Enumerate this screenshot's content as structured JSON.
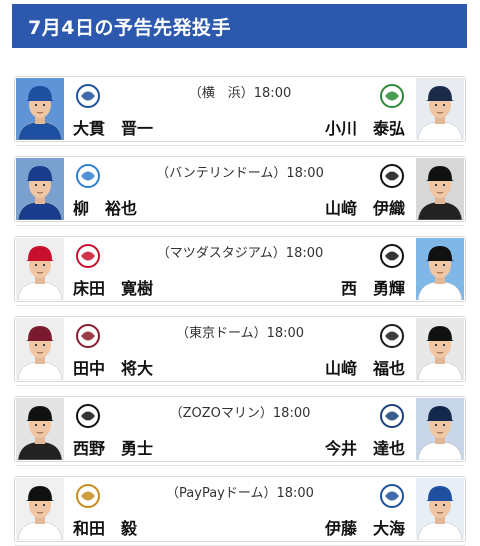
{
  "header": {
    "title": "7月4日の予告先発投手"
  },
  "games": [
    {
      "venue": "（横　浜）18:00",
      "home": {
        "name": "大貫　晋一",
        "team_logo": "baystars-logo",
        "cap": "#1f4fa0",
        "uniform": "#1f4fa0",
        "bg": "#5f95d6"
      },
      "away": {
        "name": "小川　泰弘",
        "team_logo": "swallows-logo",
        "cap": "#1a2a4a",
        "uniform": "#ffffff",
        "bg": "#e8ecf0"
      }
    },
    {
      "venue": "（バンテリンドーム）18:00",
      "home": {
        "name": "柳　裕也",
        "team_logo": "dragons-logo",
        "cap": "#1a3c8c",
        "uniform": "#1a3c8c",
        "bg": "#7aa0d0"
      },
      "away": {
        "name": "山﨑　伊織",
        "team_logo": "giants-logo",
        "cap": "#111111",
        "uniform": "#222222",
        "bg": "#d8d8d8"
      }
    },
    {
      "venue": "（マツダスタジアム）18:00",
      "home": {
        "name": "床田　寛樹",
        "team_logo": "carp-logo",
        "cap": "#c8102e",
        "uniform": "#ffffff",
        "bg": "#eeeeee"
      },
      "away": {
        "name": "西　勇輝",
        "team_logo": "tigers-logo",
        "cap": "#111111",
        "uniform": "#ffffff",
        "bg": "#7fb7e6"
      }
    },
    {
      "venue": "（東京ドーム）18:00",
      "home": {
        "name": "田中　将大",
        "team_logo": "eagles-logo",
        "cap": "#7a1a2e",
        "uniform": "#ffffff",
        "bg": "#eeeeee"
      },
      "away": {
        "name": "山﨑　福也",
        "team_logo": "buffaloes-logo",
        "cap": "#111111",
        "uniform": "#ffffff",
        "bg": "#e8e8e8"
      }
    },
    {
      "venue": "（ZOZOマリン）18:00",
      "home": {
        "name": "西野　勇士",
        "team_logo": "marines-logo",
        "cap": "#111111",
        "uniform": "#222222",
        "bg": "#e4e4e4"
      },
      "away": {
        "name": "今井　達也",
        "team_logo": "lions-logo",
        "cap": "#12284c",
        "uniform": "#ffffff",
        "bg": "#c8d6ea"
      }
    },
    {
      "venue": "（PayPayドーム）18:00",
      "home": {
        "name": "和田　毅",
        "team_logo": "hawks-logo",
        "cap": "#111111",
        "uniform": "#ffffff",
        "bg": "#f0f0f0"
      },
      "away": {
        "name": "伊藤　大海",
        "team_logo": "fighters-logo",
        "cap": "#1f4fa0",
        "uniform": "#ffffff",
        "bg": "#e8eef6"
      }
    }
  ],
  "logos": {
    "baystars-logo": {
      "text": "",
      "color": "#1f4fa0"
    },
    "swallows-logo": {
      "text": "",
      "color": "#2a8c3a"
    },
    "dragons-logo": {
      "text": "",
      "color": "#2f7fd1"
    },
    "giants-logo": {
      "text": "",
      "color": "#111111"
    },
    "carp-logo": {
      "text": "",
      "color": "#c8102e"
    },
    "tigers-logo": {
      "text": "",
      "color": "#111111"
    },
    "eagles-logo": {
      "text": "",
      "color": "#8a1c2a"
    },
    "buffaloes-logo": {
      "text": "",
      "color": "#1a1a1a"
    },
    "marines-logo": {
      "text": "",
      "color": "#111111"
    },
    "lions-logo": {
      "text": "",
      "color": "#1b3f7a"
    },
    "hawks-logo": {
      "text": "",
      "color": "#c98a1a"
    },
    "fighters-logo": {
      "text": "",
      "color": "#1f4fa0"
    }
  }
}
